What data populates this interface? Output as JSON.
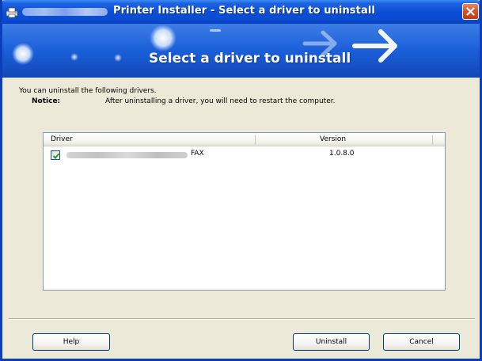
{
  "window": {
    "title": "Printer Installer - Select a driver to uninstall",
    "banner_title": "Select a driver to uninstall"
  },
  "body": {
    "intro": "You can uninstall the following drivers.",
    "notice_label": "Notice:",
    "notice_text": "After uninstalling a driver, you will need to restart the computer."
  },
  "list": {
    "columns": [
      {
        "label": "Driver"
      },
      {
        "label": "Version"
      }
    ],
    "rows": [
      {
        "driver_suffix": "FAX",
        "version": "1.0.8.0",
        "checked": true
      }
    ]
  },
  "buttons": {
    "help": "Help",
    "uninstall": "Uninstall",
    "cancel": "Cancel"
  },
  "colors": {
    "titlebar": "#0a4bd0",
    "banner": "#1a5fd8",
    "dialog_bg": "#ece9d8",
    "close_button": "#d8542d"
  },
  "icons": {
    "app": "printer-icon",
    "close": "close-icon",
    "check": "checkmark-icon",
    "banner_arrow": "arrow-right-icon"
  }
}
